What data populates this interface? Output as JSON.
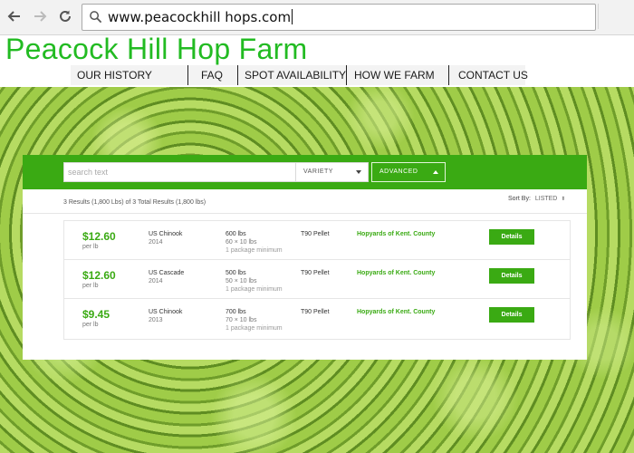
{
  "browser": {
    "url": "www.peacockhill hops.com",
    "icons": {
      "back": "back-arrow-icon",
      "forward": "forward-arrow-icon",
      "reload": "reload-icon",
      "search": "search-icon"
    }
  },
  "site": {
    "title": "Peacock Hill Hop Farm",
    "brand_color": "#22bb22"
  },
  "menu": [
    {
      "label": "OUR HISTORY"
    },
    {
      "label": "FAQ"
    },
    {
      "label": "SPOT AVAILABILITY"
    },
    {
      "label": "HOW WE FARM"
    },
    {
      "label": "CONTACT US"
    }
  ],
  "search": {
    "placeholder": "search text",
    "value": "",
    "variety_label": "VARIETY",
    "advanced_label": "ADVANCED",
    "accent_color": "#3aaa13"
  },
  "results": {
    "summary": "3 Results (1,800 Lbs) of 3 Total Results (1,800 lbs)",
    "sort_label": "Sort By:",
    "sort_value": "LISTED",
    "sort_arrows": "⬍"
  },
  "listings": [
    {
      "price": "$12.60",
      "unit": "per lb",
      "variety": "US Chinook",
      "year": "2014",
      "quantity": "600 lbs",
      "pack": "60 × 10 lbs",
      "minimum": "1 package minimum",
      "form": "T90 Pellet",
      "seller": "Hopyards of Kent. County",
      "action": "Details"
    },
    {
      "price": "$12.60",
      "unit": "per lb",
      "variety": "US Cascade",
      "year": "2014",
      "quantity": "500 lbs",
      "pack": "50 × 10 lbs",
      "minimum": "1 package minimum",
      "form": "T90 Pellet",
      "seller": "Hopyards of Kent. County",
      "action": "Details"
    },
    {
      "price": "$9.45",
      "unit": "per lb",
      "variety": "US Chinook",
      "year": "2013",
      "quantity": "700 lbs",
      "pack": "70 × 10 lbs",
      "minimum": "1 package minimum",
      "form": "T90 Pellet",
      "seller": "Hopyards of Kent. County",
      "action": "Details"
    }
  ]
}
